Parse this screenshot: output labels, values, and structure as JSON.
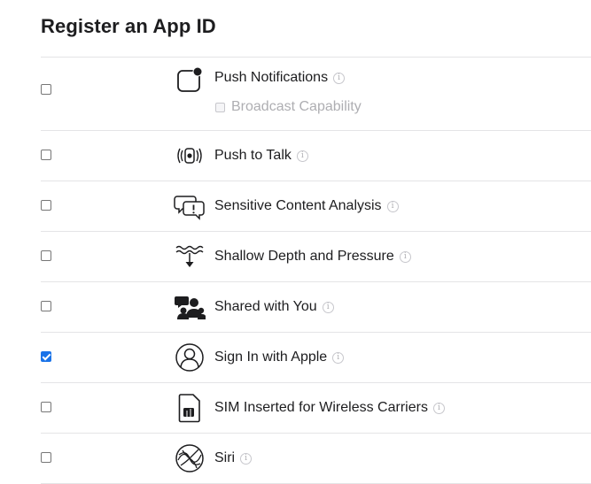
{
  "page": {
    "title": "Register an App ID"
  },
  "info_glyph": "i",
  "capabilities": [
    {
      "name": "Push Notifications",
      "icon": "push-notifications-icon",
      "checked": false,
      "sub": {
        "label": "Broadcast Capability",
        "checked": false,
        "disabled": true
      }
    },
    {
      "name": "Push to Talk",
      "icon": "push-to-talk-icon",
      "checked": false
    },
    {
      "name": "Sensitive Content Analysis",
      "icon": "sensitive-content-icon",
      "checked": false
    },
    {
      "name": "Shallow Depth and Pressure",
      "icon": "depth-pressure-icon",
      "checked": false
    },
    {
      "name": "Shared with You",
      "icon": "shared-with-you-icon",
      "checked": false
    },
    {
      "name": "Sign In with Apple",
      "icon": "sign-in-with-apple-icon",
      "checked": true
    },
    {
      "name": "SIM Inserted for Wireless Carriers",
      "icon": "sim-card-icon",
      "checked": false
    },
    {
      "name": "Siri",
      "icon": "siri-icon",
      "checked": false
    }
  ]
}
